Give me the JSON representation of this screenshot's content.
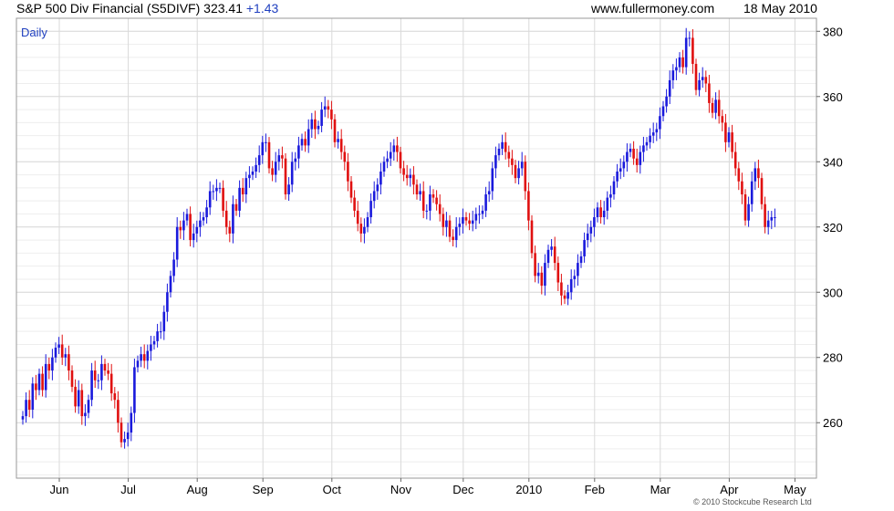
{
  "header": {
    "instrument": "S&P 500 Div Financial (S5DIVF)",
    "last": "323.41",
    "change": "+1.43",
    "site": "www.fullermoney.com",
    "date": "18 May 2010"
  },
  "copyright": "© 2010 Stockcube Research Ltd",
  "colors": {
    "up": "#1a1adc",
    "down": "#e01010",
    "grid": "#d9d9d9",
    "gridMinor": "#eeeeee"
  },
  "chart_data": {
    "type": "candlestick",
    "period_label": "Daily",
    "title": "",
    "xlabel": "",
    "ylabel": "",
    "ylim": [
      243,
      384
    ],
    "yticks": [
      260,
      280,
      300,
      320,
      340,
      360,
      380
    ],
    "xticks": [
      "Jun",
      "Jul",
      "Aug",
      "Sep",
      "Oct",
      "Nov",
      "Dec",
      "2010",
      "Feb",
      "Mar",
      "Apr",
      "May"
    ],
    "xtick_index": [
      5,
      26,
      47,
      67,
      88,
      109,
      128,
      148,
      168,
      188,
      209,
      229
    ],
    "grid": true,
    "axis_position": "right",
    "close": [
      262,
      267,
      264,
      272,
      270,
      275,
      270,
      278,
      276,
      280,
      283,
      284,
      280,
      281,
      276,
      271,
      265,
      270,
      262,
      263,
      267,
      276,
      273,
      273,
      278,
      276,
      275,
      269,
      267,
      260,
      254,
      255,
      257,
      263,
      277,
      279,
      281,
      279,
      282,
      284,
      285,
      288,
      288,
      294,
      300,
      305,
      310,
      320,
      319,
      322,
      324,
      316,
      318,
      320,
      322,
      323,
      326,
      331,
      331,
      332,
      332,
      325,
      320,
      318,
      327,
      325,
      332,
      330,
      335,
      336,
      337,
      339,
      342,
      346,
      346,
      338,
      336,
      340,
      342,
      341,
      330,
      333,
      340,
      341,
      345,
      347,
      345,
      350,
      353,
      350,
      351,
      356,
      357,
      356,
      353,
      346,
      347,
      343,
      340,
      334,
      329,
      325,
      321,
      318,
      320,
      323,
      328,
      331,
      333,
      337,
      340,
      341,
      343,
      345,
      343,
      338,
      336,
      335,
      336,
      333,
      330,
      331,
      325,
      325,
      330,
      329,
      327,
      324,
      320,
      322,
      317,
      316,
      320,
      321,
      323,
      322,
      321,
      322,
      324,
      324,
      325,
      330,
      331,
      338,
      342,
      344,
      346,
      343,
      341,
      339,
      335,
      338,
      340,
      331,
      322,
      312,
      305,
      306,
      302,
      309,
      313,
      314,
      309,
      303,
      299,
      298,
      300,
      304,
      305,
      309,
      311,
      316,
      318,
      320,
      323,
      326,
      323,
      325,
      329,
      330,
      334,
      337,
      338,
      340,
      343,
      344,
      341,
      339,
      343,
      345,
      346,
      348,
      349,
      350,
      354,
      357,
      360,
      365,
      368,
      369,
      372,
      369,
      378,
      378,
      370,
      362,
      365,
      366,
      364,
      358,
      355,
      359,
      354,
      352,
      346,
      349,
      343,
      338,
      334,
      330,
      322,
      327,
      334,
      338,
      335,
      327,
      320,
      322,
      323,
      323
    ]
  }
}
